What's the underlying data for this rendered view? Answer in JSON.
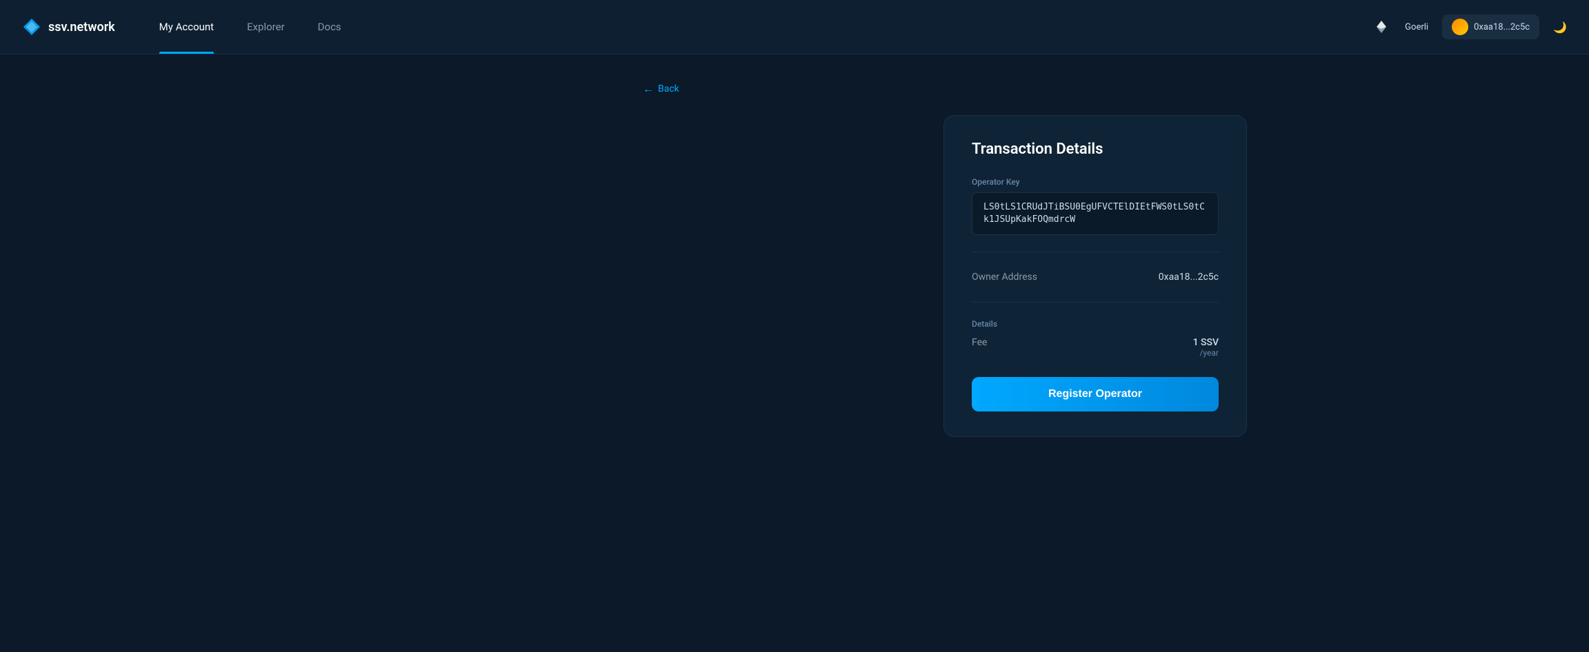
{
  "navbar": {
    "logo_text": "ssv.network",
    "links": [
      {
        "label": "My Account",
        "active": true
      },
      {
        "label": "Explorer",
        "active": false
      },
      {
        "label": "Docs",
        "active": false
      }
    ],
    "network_name": "Goerli",
    "wallet_address": "0xaa18...2c5c",
    "theme_icon": "🌙"
  },
  "back_link": {
    "arrow": "←",
    "label": "Back"
  },
  "card": {
    "title": "Transaction Details",
    "operator_key_label": "Operator Key",
    "operator_key_value": "LS0tLS1CRUdJTiBSU0EgUFVCTElDIEtFWS0tLS0tCk1JSUpKakFOQmdrcW",
    "owner_address_label": "Owner Address",
    "owner_address_value": "0xaa18...2c5c",
    "details_section_label": "Details",
    "fee_label": "Fee",
    "fee_amount": "1 SSV",
    "fee_period": "/year",
    "register_button_label": "Register Operator"
  }
}
